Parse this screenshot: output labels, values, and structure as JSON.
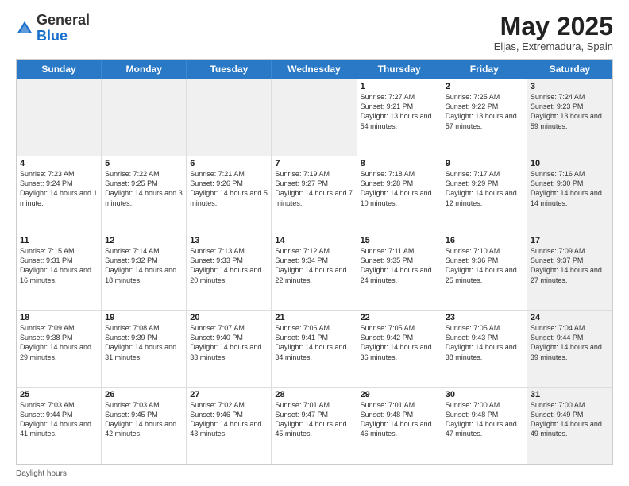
{
  "logo": {
    "general": "General",
    "blue": "Blue"
  },
  "title": "May 2025",
  "location": "Eljas, Extremadura, Spain",
  "days_of_week": [
    "Sunday",
    "Monday",
    "Tuesday",
    "Wednesday",
    "Thursday",
    "Friday",
    "Saturday"
  ],
  "footer": "Daylight hours",
  "weeks": [
    [
      {
        "day": "",
        "text": "",
        "shaded": true
      },
      {
        "day": "",
        "text": "",
        "shaded": true
      },
      {
        "day": "",
        "text": "",
        "shaded": true
      },
      {
        "day": "",
        "text": "",
        "shaded": true
      },
      {
        "day": "1",
        "text": "Sunrise: 7:27 AM\nSunset: 9:21 PM\nDaylight: 13 hours and 54 minutes.",
        "shaded": false
      },
      {
        "day": "2",
        "text": "Sunrise: 7:25 AM\nSunset: 9:22 PM\nDaylight: 13 hours and 57 minutes.",
        "shaded": false
      },
      {
        "day": "3",
        "text": "Sunrise: 7:24 AM\nSunset: 9:23 PM\nDaylight: 13 hours and 59 minutes.",
        "shaded": true
      }
    ],
    [
      {
        "day": "4",
        "text": "Sunrise: 7:23 AM\nSunset: 9:24 PM\nDaylight: 14 hours and 1 minute.",
        "shaded": false
      },
      {
        "day": "5",
        "text": "Sunrise: 7:22 AM\nSunset: 9:25 PM\nDaylight: 14 hours and 3 minutes.",
        "shaded": false
      },
      {
        "day": "6",
        "text": "Sunrise: 7:21 AM\nSunset: 9:26 PM\nDaylight: 14 hours and 5 minutes.",
        "shaded": false
      },
      {
        "day": "7",
        "text": "Sunrise: 7:19 AM\nSunset: 9:27 PM\nDaylight: 14 hours and 7 minutes.",
        "shaded": false
      },
      {
        "day": "8",
        "text": "Sunrise: 7:18 AM\nSunset: 9:28 PM\nDaylight: 14 hours and 10 minutes.",
        "shaded": false
      },
      {
        "day": "9",
        "text": "Sunrise: 7:17 AM\nSunset: 9:29 PM\nDaylight: 14 hours and 12 minutes.",
        "shaded": false
      },
      {
        "day": "10",
        "text": "Sunrise: 7:16 AM\nSunset: 9:30 PM\nDaylight: 14 hours and 14 minutes.",
        "shaded": true
      }
    ],
    [
      {
        "day": "11",
        "text": "Sunrise: 7:15 AM\nSunset: 9:31 PM\nDaylight: 14 hours and 16 minutes.",
        "shaded": false
      },
      {
        "day": "12",
        "text": "Sunrise: 7:14 AM\nSunset: 9:32 PM\nDaylight: 14 hours and 18 minutes.",
        "shaded": false
      },
      {
        "day": "13",
        "text": "Sunrise: 7:13 AM\nSunset: 9:33 PM\nDaylight: 14 hours and 20 minutes.",
        "shaded": false
      },
      {
        "day": "14",
        "text": "Sunrise: 7:12 AM\nSunset: 9:34 PM\nDaylight: 14 hours and 22 minutes.",
        "shaded": false
      },
      {
        "day": "15",
        "text": "Sunrise: 7:11 AM\nSunset: 9:35 PM\nDaylight: 14 hours and 24 minutes.",
        "shaded": false
      },
      {
        "day": "16",
        "text": "Sunrise: 7:10 AM\nSunset: 9:36 PM\nDaylight: 14 hours and 25 minutes.",
        "shaded": false
      },
      {
        "day": "17",
        "text": "Sunrise: 7:09 AM\nSunset: 9:37 PM\nDaylight: 14 hours and 27 minutes.",
        "shaded": true
      }
    ],
    [
      {
        "day": "18",
        "text": "Sunrise: 7:09 AM\nSunset: 9:38 PM\nDaylight: 14 hours and 29 minutes.",
        "shaded": false
      },
      {
        "day": "19",
        "text": "Sunrise: 7:08 AM\nSunset: 9:39 PM\nDaylight: 14 hours and 31 minutes.",
        "shaded": false
      },
      {
        "day": "20",
        "text": "Sunrise: 7:07 AM\nSunset: 9:40 PM\nDaylight: 14 hours and 33 minutes.",
        "shaded": false
      },
      {
        "day": "21",
        "text": "Sunrise: 7:06 AM\nSunset: 9:41 PM\nDaylight: 14 hours and 34 minutes.",
        "shaded": false
      },
      {
        "day": "22",
        "text": "Sunrise: 7:05 AM\nSunset: 9:42 PM\nDaylight: 14 hours and 36 minutes.",
        "shaded": false
      },
      {
        "day": "23",
        "text": "Sunrise: 7:05 AM\nSunset: 9:43 PM\nDaylight: 14 hours and 38 minutes.",
        "shaded": false
      },
      {
        "day": "24",
        "text": "Sunrise: 7:04 AM\nSunset: 9:44 PM\nDaylight: 14 hours and 39 minutes.",
        "shaded": true
      }
    ],
    [
      {
        "day": "25",
        "text": "Sunrise: 7:03 AM\nSunset: 9:44 PM\nDaylight: 14 hours and 41 minutes.",
        "shaded": false
      },
      {
        "day": "26",
        "text": "Sunrise: 7:03 AM\nSunset: 9:45 PM\nDaylight: 14 hours and 42 minutes.",
        "shaded": false
      },
      {
        "day": "27",
        "text": "Sunrise: 7:02 AM\nSunset: 9:46 PM\nDaylight: 14 hours and 43 minutes.",
        "shaded": false
      },
      {
        "day": "28",
        "text": "Sunrise: 7:01 AM\nSunset: 9:47 PM\nDaylight: 14 hours and 45 minutes.",
        "shaded": false
      },
      {
        "day": "29",
        "text": "Sunrise: 7:01 AM\nSunset: 9:48 PM\nDaylight: 14 hours and 46 minutes.",
        "shaded": false
      },
      {
        "day": "30",
        "text": "Sunrise: 7:00 AM\nSunset: 9:48 PM\nDaylight: 14 hours and 47 minutes.",
        "shaded": false
      },
      {
        "day": "31",
        "text": "Sunrise: 7:00 AM\nSunset: 9:49 PM\nDaylight: 14 hours and 49 minutes.",
        "shaded": true
      }
    ]
  ]
}
